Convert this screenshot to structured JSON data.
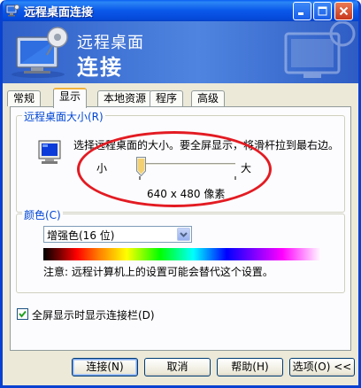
{
  "window": {
    "title": "远程桌面连接",
    "controls": [
      "minimize",
      "maximize",
      "close"
    ]
  },
  "banner": {
    "line1": "远程桌面",
    "line2": "连接"
  },
  "tabs": [
    {
      "label": "常规",
      "active": false
    },
    {
      "label": "显示",
      "active": true
    },
    {
      "label": "本地资源",
      "active": false
    },
    {
      "label": "程序",
      "active": false
    },
    {
      "label": "高级",
      "active": false
    }
  ],
  "display_size": {
    "legend": "远程桌面大小(R)",
    "description": "选择远程桌面的大小。要全屏显示，将滑杆拉到最右边。",
    "slider_min_label": "小",
    "slider_max_label": "大",
    "slider_level": 0,
    "resolution": "640 x 480 像素"
  },
  "colors": {
    "legend": "颜色(C)",
    "selected": "增强色(16 位)",
    "note": "注意: 远程计算机上的设置可能会替代这个设置。"
  },
  "fullscreen_bar": {
    "label": "全屏显示时显示连接栏(D)",
    "checked": true
  },
  "buttons": {
    "connect": "连接(N)",
    "cancel": "取消",
    "help": "帮助(H)",
    "options": "选项(O) <<"
  },
  "theme": {
    "titlebar": "#0a58ea",
    "legend_text": "#0046d5",
    "highlight_oval": "#e31b22",
    "active_tab_accent": "#f1b23c"
  }
}
